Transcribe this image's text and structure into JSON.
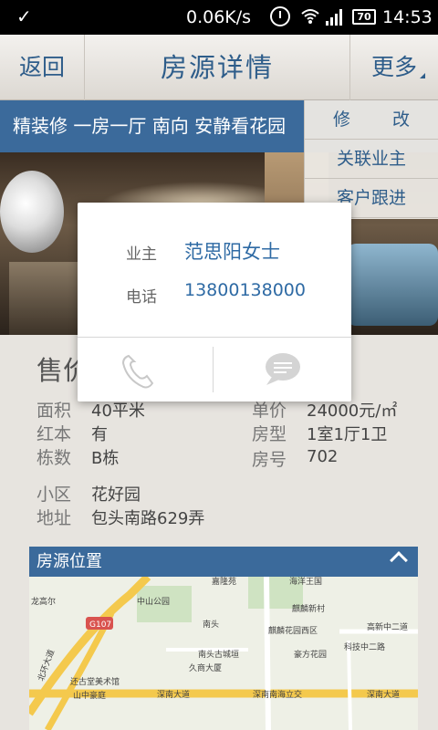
{
  "status": {
    "speed": "0.06K/s",
    "battery": "70",
    "time": "14:53"
  },
  "header": {
    "back_label": "返回",
    "title": "房源详情",
    "more_label": "更多"
  },
  "tags": "精装修  一房一厅  南向  安静看花园",
  "menu": {
    "items": [
      "修  改",
      "关联业主",
      "客户跟进"
    ]
  },
  "popup": {
    "owner_label": "业主",
    "owner_name": "范思阳女士",
    "phone_label": "电话",
    "phone_number": "13800138000"
  },
  "details": {
    "price_label": "售价",
    "area_label": "面积",
    "area_value": "40平米",
    "unit_price_label": "单价",
    "unit_price_value": "24000元/㎡",
    "red_book_label": "红本",
    "red_book_value": "有",
    "layout_label": "房型",
    "layout_value": "1室1厅1卫",
    "building_label": "栋数",
    "building_value": "B栋",
    "room_label": "房号",
    "room_value": "702",
    "community_label": "小区",
    "community_value": "花好园",
    "address_label": "地址",
    "address_value": "包头南路629弄"
  },
  "location": {
    "title": "房源位置"
  },
  "map_labels": {
    "a": "嘉隆苑",
    "b": "海洋王国",
    "c": "中山公园",
    "d": "麒麟新村",
    "e": "南头",
    "f": "麒麟花园西区",
    "g": "高新中二道",
    "h": "G107",
    "i": "南头古城垣",
    "j": "豪方花园",
    "k": "久商大厦",
    "l": "科技中二路",
    "m": "还古堂美术馆",
    "n": "深南大道",
    "o": "深南南海立交",
    "p": "山中豪庭",
    "q": "北环大道",
    "r": "龙高尔",
    "s": "深南大道"
  },
  "colors": {
    "accent": "#3b6a9b",
    "link": "#2e5d8a"
  }
}
